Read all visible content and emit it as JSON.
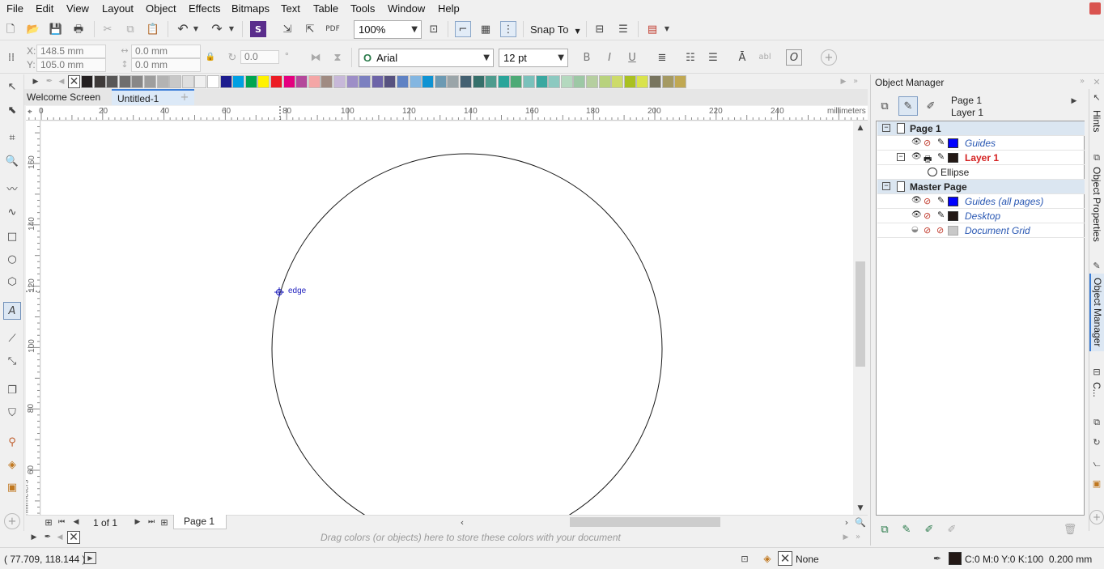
{
  "menubar": {
    "items": [
      "File",
      "Edit",
      "View",
      "Layout",
      "Object",
      "Effects",
      "Bitmaps",
      "Text",
      "Table",
      "Tools",
      "Window",
      "Help"
    ]
  },
  "toolbar": {
    "zoom": "100%",
    "snap_to": "Snap To"
  },
  "property_bar": {
    "x": "X:",
    "x_value": "148.5 mm",
    "y": "Y:",
    "y_value": "105.0 mm",
    "w_value": "0.0 mm",
    "h_value": "0.0 mm",
    "angle": "0.0",
    "degree": "°",
    "font": "Arial",
    "font_size": "12 pt",
    "ab_label": "abl"
  },
  "colors": {
    "accent": "#0078d7",
    "layer_red": "#d42020",
    "link_blue": "#2a58b3",
    "palette": [
      "#231f20",
      "#3e3a39",
      "#585757",
      "#6f6e6e",
      "#888787",
      "#9e9e9e",
      "#b3b3b3",
      "#c8c8c8",
      "#dedede",
      "#f0f0f0",
      "#ffffff",
      "#1d1d8f",
      "#00a0e3",
      "#00a651",
      "#fff200",
      "#ec1c24",
      "#e4007f",
      "#b4489b",
      "#f4a6a6",
      "#a08b82",
      "#c7b8d9",
      "#9d8ec7",
      "#7b80c0",
      "#6d64a8",
      "#575280",
      "#5f82c4",
      "#83b6e1",
      "#0e93d3",
      "#6c9ab3",
      "#9aa5a9",
      "#446172",
      "#36706b",
      "#4e9c8e",
      "#2aa59a",
      "#4daa76",
      "#7ac1bb",
      "#3aa8a0",
      "#8cc9c0",
      "#b4d9bf",
      "#9dc8a5",
      "#b6cf9f",
      "#b8d27d",
      "#cddb6a",
      "#a9c021",
      "#d9e34c",
      "#78755f",
      "#a59a63",
      "#c0a852"
    ]
  },
  "doc_tabs": {
    "welcome": "Welcome Screen",
    "untitled": "Untitled-1"
  },
  "ruler": {
    "h_ticks": [
      "0",
      "20",
      "40",
      "60",
      "80",
      "100",
      "120",
      "140",
      "160",
      "180",
      "200",
      "220",
      "240"
    ],
    "unit": "millimeters",
    "v_ticks": [
      "160",
      "140",
      "120",
      "100",
      "80",
      "60"
    ],
    "v_unit": "millimeters"
  },
  "canvas": {
    "snap_label": "edge"
  },
  "page_nav": {
    "count": "1 of 1",
    "page_tab": "Page 1"
  },
  "doc_palette_hint": "Drag colors (or objects) here to store these colors with your document",
  "object_manager": {
    "title": "Object Manager",
    "page": "Page 1",
    "layer": "Layer 1",
    "tree": {
      "page1": "Page 1",
      "guides": "Guides",
      "layer1": "Layer 1",
      "ellipse": "Ellipse",
      "master": "Master Page",
      "guides_all": "Guides (all pages)",
      "desktop": "Desktop",
      "doc_grid": "Document Grid"
    }
  },
  "side_tabs": {
    "hints": "Hints",
    "props": "Object Properties",
    "manager": "Object Manager",
    "c": "C..."
  },
  "status": {
    "coords": "( 77.709, 118.144 )",
    "fill": "None",
    "outline": "C:0 M:0 Y:0 K:100  0.200 mm"
  }
}
